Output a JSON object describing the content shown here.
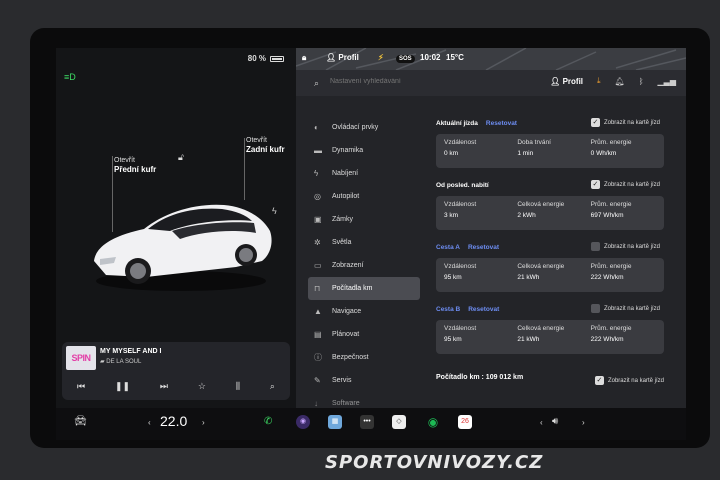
{
  "status": {
    "battery": "80 %",
    "profile": "Profil",
    "time": "10:02",
    "temp": "15°C",
    "sos": "SOS"
  },
  "car": {
    "front_trunk_action": "Otevřít",
    "front_trunk": "Přední kufr",
    "rear_trunk_action": "Otevřít",
    "rear_trunk": "Zadní kufr"
  },
  "media": {
    "album_art_text": "SPIN",
    "track": "MY MYSELF AND I",
    "artist": "DE LA SOUL"
  },
  "search": {
    "placeholder": "Nastavení vyhledávání"
  },
  "header": {
    "profile": "Profil"
  },
  "menu": [
    {
      "icon": "toggle-icon",
      "glyph": "◐",
      "label": "Ovládací prvky"
    },
    {
      "icon": "car-icon",
      "glyph": "▬",
      "label": "Dynamika"
    },
    {
      "icon": "bolt-icon",
      "glyph": "ϟ",
      "label": "Nabíjení"
    },
    {
      "icon": "steering-icon",
      "glyph": "◎",
      "label": "Autopilot"
    },
    {
      "icon": "lock-icon",
      "glyph": "▣",
      "label": "Zámky"
    },
    {
      "icon": "light-icon",
      "glyph": "✲",
      "label": "Světla"
    },
    {
      "icon": "display-icon",
      "glyph": "▭",
      "label": "Zobrazení"
    },
    {
      "icon": "trip-icon",
      "glyph": "⊓",
      "label": "Počítadla km"
    },
    {
      "icon": "navigation-icon",
      "glyph": "▲",
      "label": "Navigace"
    },
    {
      "icon": "calendar-icon",
      "glyph": "▤",
      "label": "Plánovat"
    },
    {
      "icon": "safety-icon",
      "glyph": "ⓘ",
      "label": "Bezpečnost"
    },
    {
      "icon": "wrench-icon",
      "glyph": "✎",
      "label": "Servis"
    },
    {
      "icon": "download-icon",
      "glyph": "↓",
      "label": "Software"
    }
  ],
  "trips": [
    {
      "title": "Aktuální jízda",
      "title_blue": false,
      "reset": "Resetovat",
      "show_label": "Zobrazit na kartě jízd",
      "show": true,
      "cells": [
        {
          "k": "Vzdálenost",
          "v": "0 km"
        },
        {
          "k": "Doba trvání",
          "v": "1 min"
        },
        {
          "k": "Prům. energie",
          "v": "0 Wh/km"
        }
      ]
    },
    {
      "title": "Od posled. nabití",
      "title_blue": false,
      "reset": "",
      "show_label": "Zobrazit na kartě jízd",
      "show": true,
      "cells": [
        {
          "k": "Vzdálenost",
          "v": "3 km"
        },
        {
          "k": "Celková energie",
          "v": "2 kWh"
        },
        {
          "k": "Prům. energie",
          "v": "697 Wh/km"
        }
      ]
    },
    {
      "title": "Cesta A",
      "title_blue": true,
      "reset": "Resetovat",
      "show_label": "Zobrazit na kartě jízd",
      "show": false,
      "cells": [
        {
          "k": "Vzdálenost",
          "v": "95 km"
        },
        {
          "k": "Celková energie",
          "v": "21 kWh"
        },
        {
          "k": "Prům. energie",
          "v": "222 Wh/km"
        }
      ]
    },
    {
      "title": "Cesta B",
      "title_blue": true,
      "reset": "Resetovat",
      "show_label": "Zobrazit na kartě jízd",
      "show": false,
      "cells": [
        {
          "k": "Vzdálenost",
          "v": "95 km"
        },
        {
          "k": "Celková energie",
          "v": "21 kWh"
        },
        {
          "k": "Prům. energie",
          "v": "222 Wh/km"
        }
      ]
    }
  ],
  "odometer": {
    "label": "Počítadlo km :",
    "value": "109 012 km",
    "show_label": "Zobrazit na kartě jízd"
  },
  "dock": {
    "temperature": "22.0",
    "calendar_day": "26"
  },
  "watermark": "SPORTOVNIVOZY.CZ",
  "colors": {
    "accent": "#6d8df2",
    "headlights": "#3ddc64",
    "spotify": "#1db954"
  }
}
